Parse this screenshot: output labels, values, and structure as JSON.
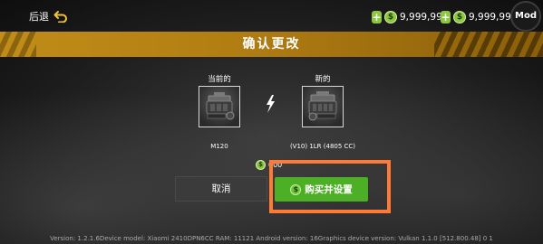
{
  "topbar": {
    "back_label": "后退",
    "currencies": [
      {
        "plus": "+",
        "coin": "$",
        "amount": "9,999,999"
      },
      {
        "plus": "+",
        "coin": "$",
        "amount": "9,999,999"
      }
    ],
    "mod_badge": "Mod"
  },
  "title": "确认更改",
  "comparison": {
    "current": {
      "label": "当前的",
      "name": "M120"
    },
    "new": {
      "label": "新的",
      "name": "(V10) 1LR (4805 CC)"
    }
  },
  "price": {
    "coin": "$",
    "value": "000"
  },
  "buttons": {
    "cancel_label": "取消",
    "buy_label": "购买并设置",
    "buy_coin": "$"
  },
  "colors": {
    "accent_gold": "#c18d18",
    "buy_green": "#4caf26",
    "highlight_orange": "#ff7a35",
    "coin_green": "#8dc63f"
  },
  "footer": "Version: 1.2.1.6Device model: Xiaomi 2410DPN6CC RAM: 11121 Android version: 16Graphics device version: Vulkan 1.1.0 [512.800.48] 0 1"
}
